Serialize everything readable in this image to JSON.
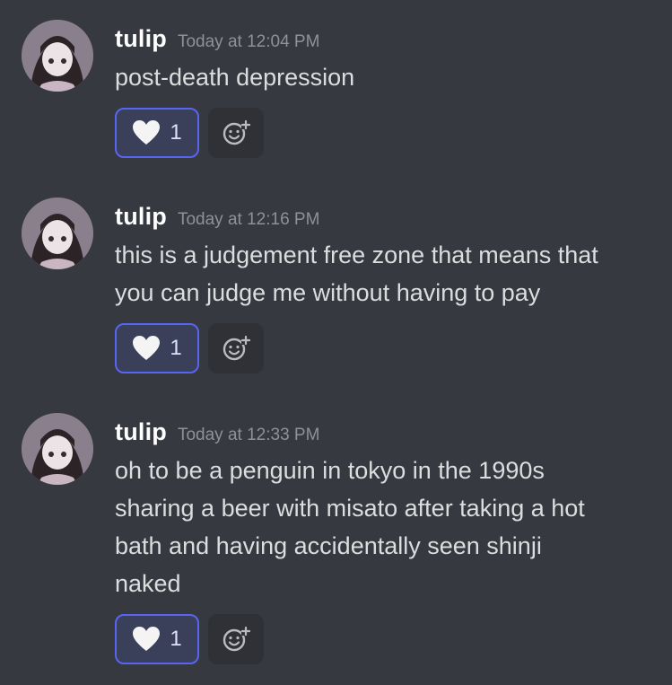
{
  "messages": [
    {
      "username": "tulip",
      "timestamp": "Today at 12:04 PM",
      "lines": [
        "post-death depression"
      ],
      "reaction": {
        "emoji": "white-heart-icon",
        "count": "1"
      }
    },
    {
      "username": "tulip",
      "timestamp": "Today at 12:16 PM",
      "lines": [
        "this is a judgement free zone that means that",
        "you can judge me without having to pay"
      ],
      "reaction": {
        "emoji": "white-heart-icon",
        "count": "1"
      }
    },
    {
      "username": "tulip",
      "timestamp": "Today at 12:33 PM",
      "lines": [
        "oh to be a penguin in tokyo in the 1990s",
        "sharing a beer with misato after taking a hot",
        "bath and having accidentally seen shinji",
        "naked"
      ],
      "reaction": {
        "emoji": "white-heart-icon",
        "count": "1"
      }
    }
  ],
  "colors": {
    "background": "#36393f",
    "username": "#ffffff",
    "timestamp": "#8e9297",
    "text": "#dcddde",
    "reaction_border": "#5865f2",
    "reaction_bg": "#3b405a"
  }
}
